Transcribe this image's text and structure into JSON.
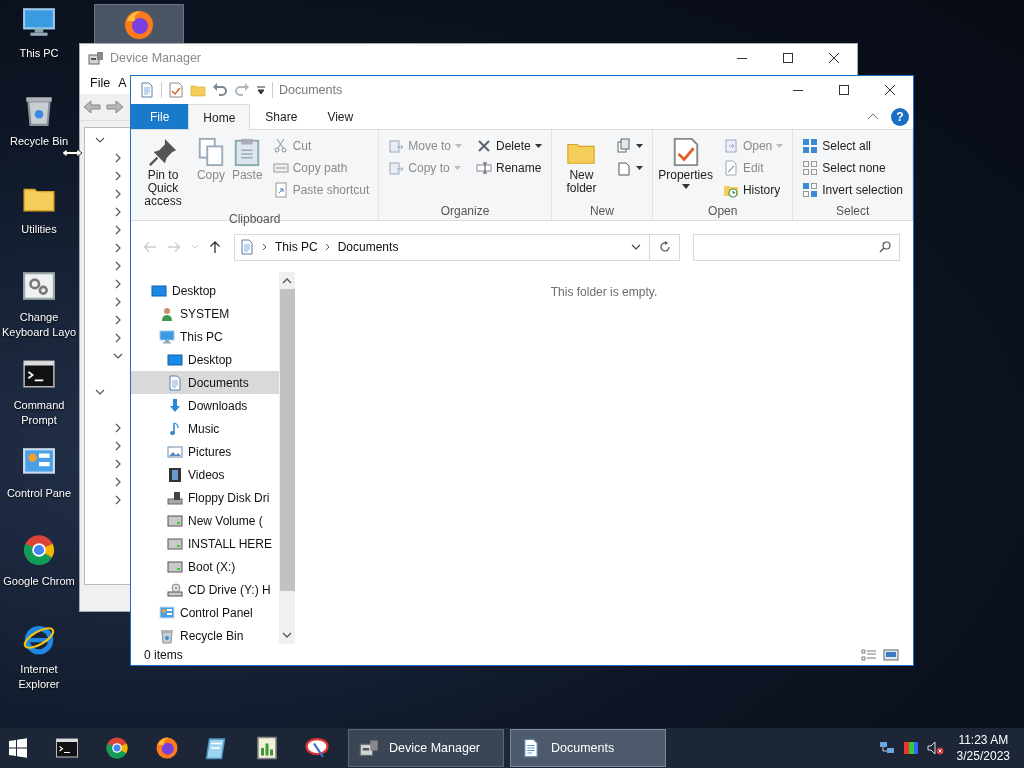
{
  "desktop_icons": [
    {
      "label": "This PC",
      "kind": "computer"
    },
    {
      "label": "Recycle Bin",
      "kind": "recycle-bin"
    },
    {
      "label": "Utilities",
      "kind": "folder"
    },
    {
      "label": "Change Keyboard Layo",
      "kind": "gears-window"
    },
    {
      "label": "Command Prompt",
      "kind": "terminal"
    },
    {
      "label": "Control Pane",
      "kind": "control-panel"
    },
    {
      "label": "Google Chrom",
      "kind": "chrome-logo"
    },
    {
      "label": "Internet Explorer",
      "kind": "ie-logo"
    }
  ],
  "dragged_tile": {
    "kind": "firefox-logo"
  },
  "device_manager": {
    "title": "Device Manager",
    "menu": [
      "File",
      "A"
    ],
    "tree": [
      {
        "expanded": true,
        "children": [
          {
            "expanded": false
          },
          {
            "expanded": false
          },
          {
            "expanded": false
          },
          {
            "expanded": false
          },
          {
            "expanded": false
          },
          {
            "expanded": false
          },
          {
            "expanded": false
          },
          {
            "expanded": false
          },
          {
            "expanded": false
          },
          {
            "expanded": false
          },
          {
            "expanded": false
          },
          {
            "expanded": true,
            "children": [
              {
                "leaf": true
              }
            ]
          }
        ]
      },
      {
        "expanded": true,
        "children": [
          {
            "leaf": true
          },
          {
            "expanded": false
          },
          {
            "expanded": false
          },
          {
            "expanded": false
          },
          {
            "expanded": false
          },
          {
            "expanded": false
          }
        ]
      }
    ]
  },
  "explorer": {
    "title": "Documents",
    "tabs": [
      {
        "label": "File",
        "kind": "file",
        "selected": false
      },
      {
        "label": "Home",
        "kind": "tab",
        "selected": true
      },
      {
        "label": "Share",
        "kind": "tab",
        "selected": false
      },
      {
        "label": "View",
        "kind": "tab",
        "selected": false
      }
    ],
    "help_label": "?",
    "ribbon_groups": [
      {
        "label": "Clipboard",
        "large": [
          {
            "label": "Pin to Quick access",
            "kind": "pushpin",
            "disabled": false
          },
          {
            "label": "Copy",
            "kind": "pages",
            "disabled": true
          },
          {
            "label": "Paste",
            "kind": "clipboard",
            "disabled": true
          }
        ],
        "stacks": [
          [
            {
              "label": "Cut",
              "kind": "scissors",
              "disabled": true
            },
            {
              "label": "Copy path",
              "kind": "path-card",
              "disabled": true
            },
            {
              "label": "Paste shortcut",
              "kind": "shortcut-page",
              "disabled": true
            }
          ]
        ]
      },
      {
        "label": "Organize",
        "stacks": [
          [
            {
              "label": "Move to",
              "kind": "move-page",
              "disabled": true,
              "dropdown": true
            },
            {
              "label": "Copy to",
              "kind": "copy-page",
              "disabled": true,
              "dropdown": true
            }
          ],
          [
            {
              "label": "Delete",
              "kind": "x-mark",
              "disabled": false,
              "dropdown": true
            },
            {
              "label": "Rename",
              "kind": "rename-field",
              "disabled": false
            }
          ]
        ]
      },
      {
        "label": "New",
        "large": [
          {
            "label": "New folder",
            "kind": "folder",
            "disabled": false
          }
        ],
        "stacks": [
          [
            {
              "kind": "new-item",
              "disabled": false,
              "dropdown": true
            },
            {
              "kind": "page-stack",
              "disabled": false,
              "dropdown": true
            }
          ]
        ]
      },
      {
        "label": "Open",
        "large": [
          {
            "label": "Properties",
            "kind": "check-page",
            "disabled": false,
            "dropdown": true
          }
        ],
        "stacks": [
          [
            {
              "label": "Open",
              "kind": "open-page",
              "disabled": true,
              "dropdown": true
            },
            {
              "label": "Edit",
              "kind": "pencil-page",
              "disabled": true
            },
            {
              "label": "History",
              "kind": "clock-folder",
              "disabled": false
            }
          ]
        ]
      },
      {
        "label": "Select",
        "stacks": [
          [
            {
              "label": "Select all",
              "kind": "grid-full",
              "disabled": false
            },
            {
              "label": "Select none",
              "kind": "grid-empty",
              "disabled": false
            },
            {
              "label": "Invert selection",
              "kind": "grid-half",
              "disabled": false
            }
          ]
        ]
      }
    ],
    "breadcrumb": [
      "This PC",
      "Documents"
    ],
    "nav": [
      {
        "label": "Desktop",
        "kind": "monitor",
        "selected": false,
        "children": [
          {
            "label": "SYSTEM",
            "kind": "user",
            "selected": false
          },
          {
            "label": "This PC",
            "kind": "computer",
            "selected": false,
            "children": [
              {
                "label": "Desktop",
                "kind": "monitor",
                "selected": false
              },
              {
                "label": "Documents",
                "kind": "document",
                "selected": true
              },
              {
                "label": "Downloads",
                "kind": "down-arrow",
                "selected": false
              },
              {
                "label": "Music",
                "kind": "music-note",
                "selected": false
              },
              {
                "label": "Pictures",
                "kind": "picture",
                "selected": false
              },
              {
                "label": "Videos",
                "kind": "film",
                "selected": false
              },
              {
                "label": "Floppy Disk Dri",
                "kind": "floppy-drive",
                "selected": false
              },
              {
                "label": "New Volume (",
                "kind": "drive",
                "selected": false
              },
              {
                "label": "INSTALL HERE",
                "kind": "drive",
                "selected": false
              },
              {
                "label": "Boot (X:)",
                "kind": "drive",
                "selected": false
              },
              {
                "label": "CD Drive (Y:) H",
                "kind": "cd-drive",
                "selected": false
              }
            ]
          },
          {
            "label": "Control Panel",
            "kind": "control-panel",
            "selected": false
          },
          {
            "label": "Recycle Bin",
            "kind": "recycle-bin",
            "selected": false
          }
        ]
      }
    ],
    "empty_message": "This folder is empty.",
    "status": "0 items"
  },
  "taskbar": {
    "pinned": [
      {
        "kind": "terminal"
      },
      {
        "kind": "chrome-logo"
      },
      {
        "kind": "firefox-logo"
      },
      {
        "kind": "notepad"
      },
      {
        "kind": "chart-page"
      },
      {
        "kind": "drawing-tool"
      }
    ],
    "windows": [
      {
        "label": "Device Manager",
        "kind": "device-manager",
        "selected": false
      },
      {
        "label": "Documents",
        "kind": "document",
        "selected": true
      }
    ],
    "time": "11:23 AM",
    "date": "3/25/2023"
  }
}
